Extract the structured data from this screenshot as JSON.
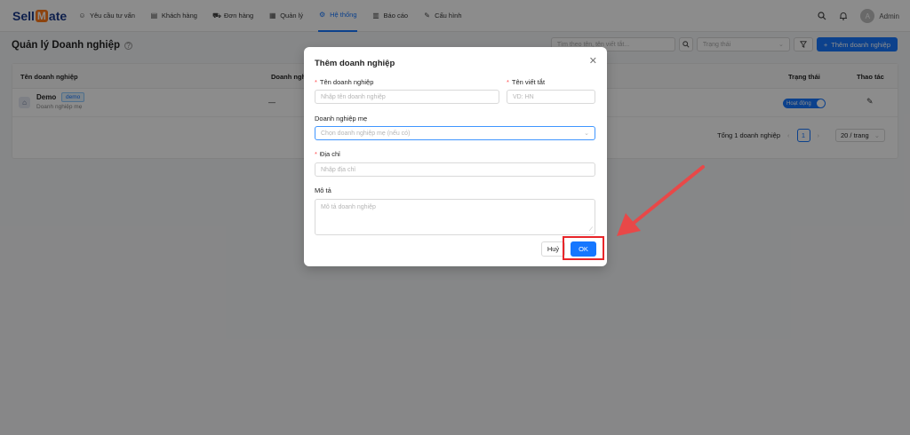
{
  "brand": {
    "logo_pre": "Sell",
    "logo_m": "M",
    "logo_post": "ate"
  },
  "nav": {
    "items": [
      {
        "label": "Yêu cầu tư vấn",
        "icon": "chat-icon",
        "glyph": "☺"
      },
      {
        "label": "Khách hàng",
        "icon": "contacts-icon",
        "glyph": "▤"
      },
      {
        "label": "Đơn hàng",
        "icon": "cart-icon",
        "glyph": "⛟"
      },
      {
        "label": "Quản lý",
        "icon": "grid-icon",
        "glyph": "▦"
      },
      {
        "label": "Hệ thống",
        "icon": "gear-icon",
        "glyph": "⚙"
      },
      {
        "label": "Báo cáo",
        "icon": "bar-chart-icon",
        "glyph": "▥"
      },
      {
        "label": "Cấu hình",
        "icon": "wrench-icon",
        "glyph": "✎"
      }
    ],
    "active_index": 4
  },
  "user": {
    "avatar_letter": "A",
    "name": "Admin"
  },
  "page": {
    "title": "Quản lý Doanh nghiệp",
    "help": "?"
  },
  "toolbar": {
    "search_placeholder": "Tìm theo tên, tên viết tắt...",
    "status_placeholder": "Trạng thái",
    "add_label": "Thêm doanh nghiệp"
  },
  "table": {
    "headers": {
      "name": "Tên doanh nghiệp",
      "parent": "Doanh nghiệp",
      "status": "Trạng thái",
      "actions": "Thao tác"
    },
    "rows": [
      {
        "name": "Demo",
        "tag": "demo",
        "sub": "Doanh nghiệp mẹ",
        "parent": "—",
        "status": "Hoạt động"
      }
    ]
  },
  "pagination": {
    "total": "Tổng 1 doanh nghiệp",
    "current": "1",
    "page_size": "20 / trang"
  },
  "modal": {
    "title": "Thêm doanh nghiệp",
    "name_label": "Tên doanh nghiệp",
    "name_placeholder": "Nhập tên doanh nghiệp",
    "short_label": "Tên viết tắt",
    "short_placeholder": "VD: HN",
    "parent_label": "Doanh nghiệp mẹ",
    "parent_placeholder": "Chọn doanh nghiệp mẹ (nếu có)",
    "address_label": "Địa chỉ",
    "address_placeholder": "Nhập địa chỉ",
    "desc_label": "Mô tả",
    "desc_placeholder": "Mô tả doanh nghiệp",
    "cancel_label": "Huỷ",
    "ok_label": "OK"
  },
  "colors": {
    "primary": "#1677ff",
    "highlight": "#e8262a",
    "brand_accent": "#ff7a1a"
  }
}
